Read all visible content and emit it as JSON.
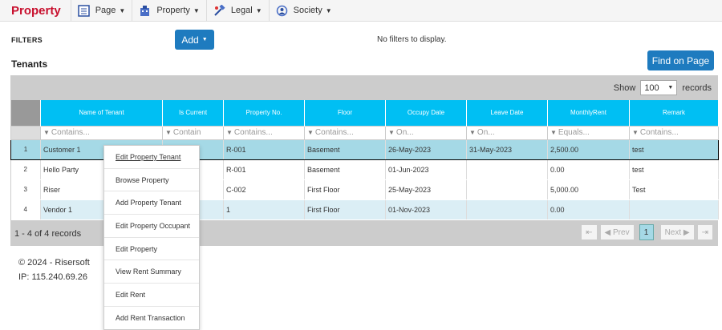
{
  "header": {
    "brand": "Property",
    "menus": [
      {
        "label": "Page",
        "icon": "page-icon"
      },
      {
        "label": "Property",
        "icon": "building-icon"
      },
      {
        "label": "Legal",
        "icon": "legal-icon"
      },
      {
        "label": "Society",
        "icon": "society-icon"
      }
    ]
  },
  "filters": {
    "label": "FILTERS",
    "add_label": "Add",
    "empty_text": "No filters to display."
  },
  "find_label": "Find on Page",
  "section_title": "Tenants",
  "grid": {
    "show_label": "Show",
    "show_value": "100",
    "records_label": "records",
    "columns": [
      "Name of Tenant",
      "Is Current",
      "Property No.",
      "Floor",
      "Occupy Date",
      "Leave Date",
      "MonthlyRent",
      "Remark"
    ],
    "filter_placeholders": [
      "Contains...",
      "Contain",
      "Contains...",
      "Contains...",
      "On...",
      "On...",
      "Equals...",
      "Contains..."
    ],
    "rows": [
      {
        "num": "1",
        "cells": [
          "Customer 1",
          "",
          "R-001",
          "Basement",
          "26-May-2023",
          "31-May-2023",
          "2,500.00",
          "test"
        ]
      },
      {
        "num": "2",
        "cells": [
          "Hello Party",
          "",
          "R-001",
          "Basement",
          "01-Jun-2023",
          "",
          "0.00",
          "test"
        ]
      },
      {
        "num": "3",
        "cells": [
          "Riser",
          "",
          "C-002",
          "First Floor",
          "25-May-2023",
          "",
          "5,000.00",
          "Test"
        ]
      },
      {
        "num": "4",
        "cells": [
          "Vendor 1",
          "",
          "1",
          "First Floor",
          "01-Nov-2023",
          "",
          "0.00",
          ""
        ]
      }
    ],
    "pager_info": "1 - 4 of 4 records",
    "pager": {
      "first": "⇤",
      "prev": "Prev",
      "current": "1",
      "next": "Next",
      "last": "⇥"
    }
  },
  "context_menu": [
    "Edit Property Tenant",
    "Browse Property",
    "Add Property Tenant",
    "Edit Property Occupant",
    "Edit Property",
    "View Rent Summary",
    "Edit Rent",
    "Add Rent Transaction"
  ],
  "footer": {
    "copyright": "© 2024 - Risersoft",
    "ip": "IP: 115.240.69.26"
  },
  "colors": {
    "brand": "#c8102e",
    "button": "#1e7bbf",
    "header": "#00bff3",
    "selected_row": "#a5d9e6"
  }
}
